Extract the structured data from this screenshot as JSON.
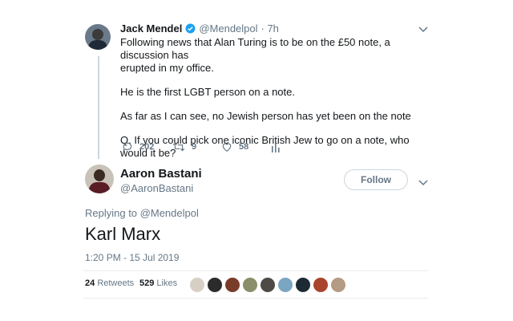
{
  "tweet1": {
    "name": "Jack Mendel",
    "handle": "@Mendelpol",
    "time": "· 7h",
    "lines": [
      "Following news that Alan Turing is to be on the £50 note, a discussion has",
      "erupted in my office.",
      "He is the first LGBT person on a note.",
      "As far as I can see, no Jewish person has yet been on the note",
      "Q. If you could pick one iconic British Jew to go on a note, who would it be?"
    ],
    "replies": "202",
    "retweets": "9",
    "likes": "58"
  },
  "tweet2": {
    "name": "Aaron Bastani",
    "handle": "@AaronBastani",
    "follow_label": "Follow",
    "replying_prefix": "Replying to",
    "replying_handle": "@Mendelpol",
    "text": "Karl Marx",
    "timestamp": "1:20 PM - 15 Jul 2019",
    "retweet_count": "24",
    "retweet_label": "Retweets",
    "like_count": "529",
    "like_label": "Likes"
  },
  "colors": {
    "verified": "#1da1f2",
    "muted": "#657786",
    "link": "#657786",
    "divider": "#e6ecf0"
  },
  "icons": [
    "verified-badge-icon",
    "chevron-down-icon",
    "reply-icon",
    "retweet-icon",
    "like-icon",
    "analytics-icon"
  ]
}
